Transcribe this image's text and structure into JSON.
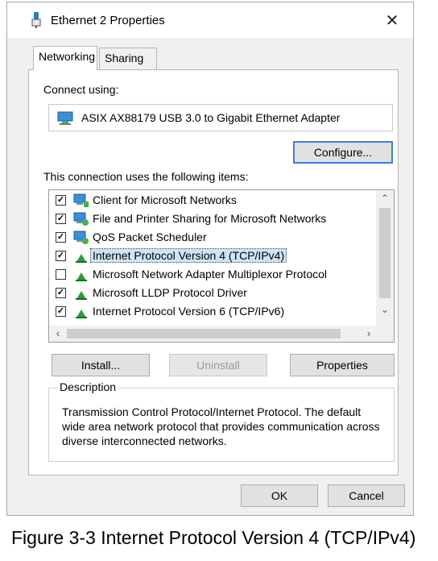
{
  "window": {
    "title": "Ethernet 2 Properties",
    "icon": "network-adapter-icon",
    "close_label": "✕"
  },
  "tabs": [
    {
      "label": "Networking",
      "active": true
    },
    {
      "label": "Sharing",
      "active": false
    }
  ],
  "connect_using": {
    "label": "Connect using:",
    "adapter_name": "ASIX AX88179 USB 3.0 to Gigabit Ethernet Adapter",
    "adapter_icon": "network-card-icon"
  },
  "buttons": {
    "configure": "Configure...",
    "install": "Install...",
    "uninstall": "Uninstall",
    "properties": "Properties",
    "ok": "OK",
    "cancel": "Cancel"
  },
  "items_label": "This connection uses the following items:",
  "items": [
    {
      "label": "Client for Microsoft Networks",
      "checked": true,
      "icon": "client-icon"
    },
    {
      "label": "File and Printer Sharing for Microsoft Networks",
      "checked": true,
      "icon": "service-icon"
    },
    {
      "label": "QoS Packet Scheduler",
      "checked": true,
      "icon": "service-icon"
    },
    {
      "label": "Internet Protocol Version 4 (TCP/IPv4)",
      "checked": true,
      "icon": "protocol-icon",
      "selected": true
    },
    {
      "label": "Microsoft Network Adapter Multiplexor Protocol",
      "checked": false,
      "icon": "protocol-icon"
    },
    {
      "label": "Microsoft LLDP Protocol Driver",
      "checked": true,
      "icon": "protocol-icon"
    },
    {
      "label": "Internet Protocol Version 6 (TCP/IPv6)",
      "checked": true,
      "icon": "protocol-icon"
    }
  ],
  "description": {
    "title": "Description",
    "text": "Transmission Control Protocol/Internet Protocol. The default wide area network protocol that provides communication across diverse interconnected networks."
  },
  "caption": "Figure 3-3 Internet Protocol Version 4 (TCP/IPv4)",
  "colors": {
    "selection": "#cce4f7",
    "focus_border": "#3f7fd5",
    "icon_green": "#2e9b3a",
    "icon_blue": "#1e7fd0"
  }
}
